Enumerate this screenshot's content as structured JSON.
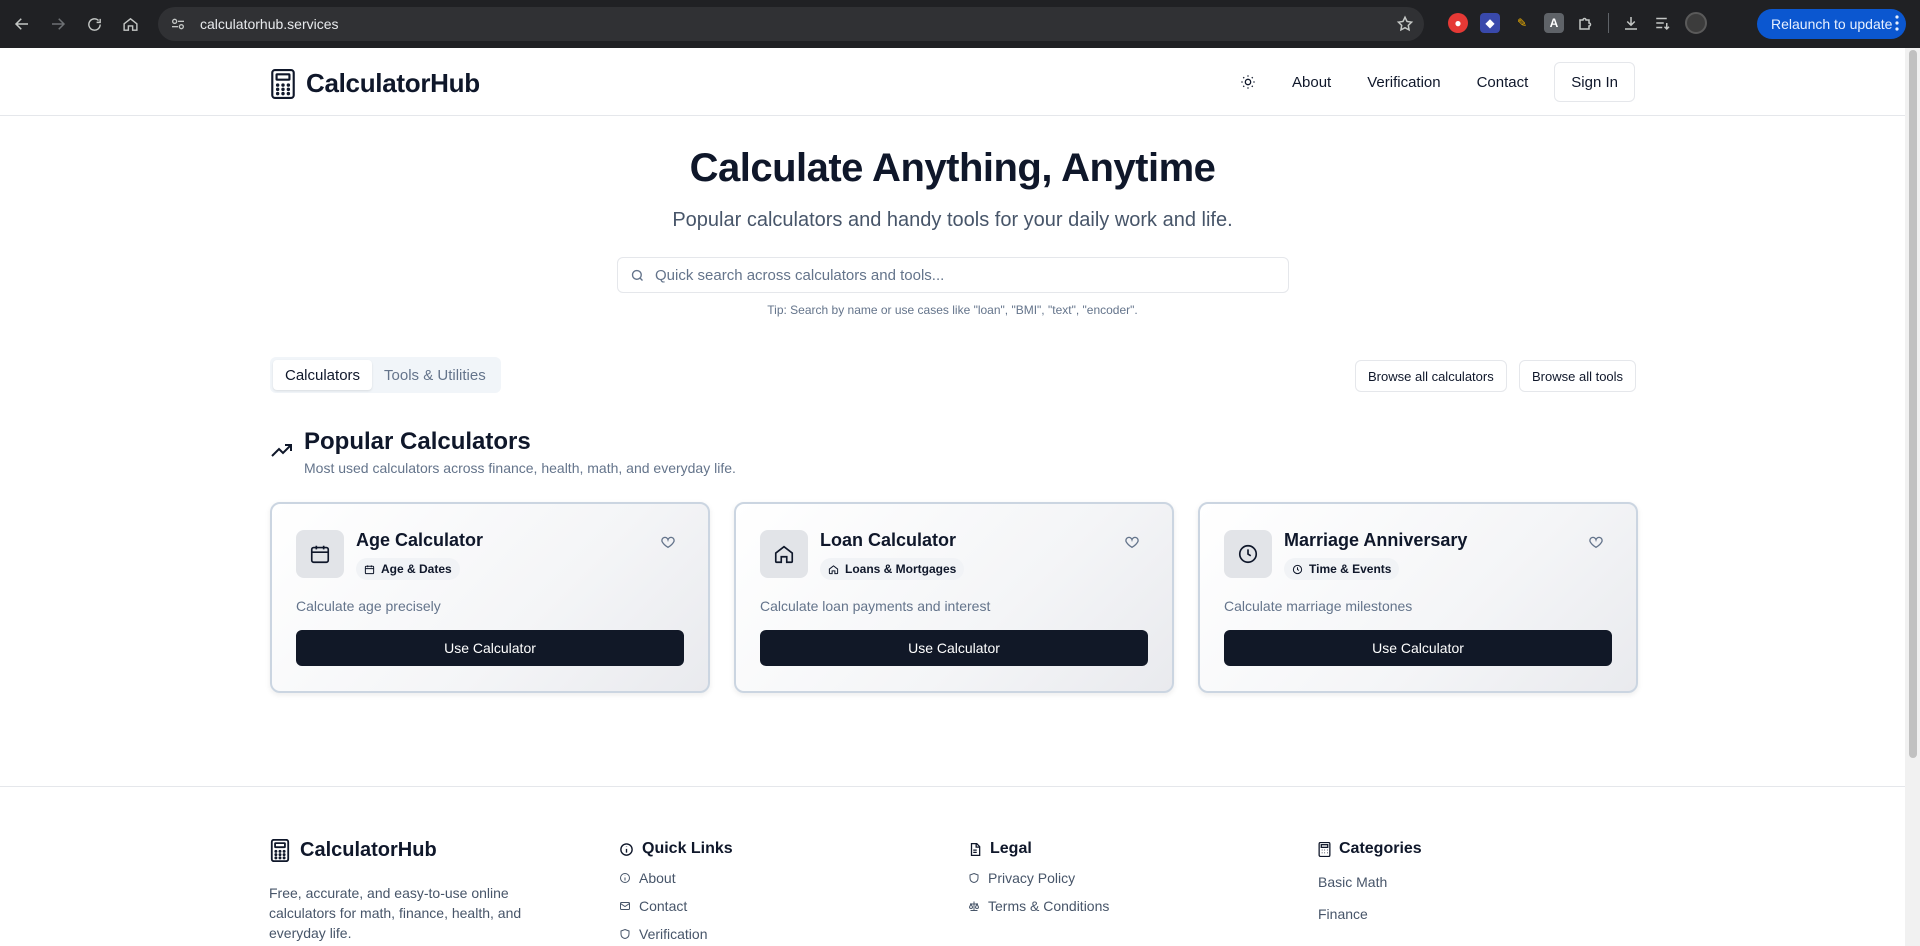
{
  "browser": {
    "url": "calculatorhub.services",
    "relaunch_label": "Relaunch to update"
  },
  "header": {
    "brand": "CalculatorHub",
    "nav": {
      "about": "About",
      "verification": "Verification",
      "contact": "Contact"
    },
    "signin_label": "Sign In"
  },
  "hero": {
    "title": "Calculate Anything, Anytime",
    "subtitle": "Popular calculators and handy tools for your daily work and life.",
    "search_placeholder": "Quick search across calculators and tools...",
    "search_value": "",
    "tip": "Tip: Search by name or use cases like \"loan\", \"BMI\", \"text\", \"encoder\"."
  },
  "tabs": {
    "calculators": "Calculators",
    "tools": "Tools & Utilities",
    "active": "Calculators"
  },
  "browse": {
    "calculators": "Browse all calculators",
    "tools": "Browse all tools"
  },
  "section": {
    "title": "Popular Calculators",
    "subtitle": "Most used calculators across finance, health, math, and everyday life."
  },
  "cards": [
    {
      "title": "Age Calculator",
      "category": "Age & Dates",
      "description": "Calculate age precisely",
      "button": "Use Calculator",
      "icon": "calendar-icon"
    },
    {
      "title": "Loan Calculator",
      "category": "Loans & Mortgages",
      "description": "Calculate loan payments and interest",
      "button": "Use Calculator",
      "icon": "home-icon"
    },
    {
      "title": "Marriage Anniversary",
      "category": "Time & Events",
      "description": "Calculate marriage milestones",
      "button": "Use Calculator",
      "icon": "clock-icon"
    }
  ],
  "footer": {
    "brand": "CalculatorHub",
    "description": "Free, accurate, and easy-to-use online calculators for math, finance, health, and everyday life.",
    "quick_links": {
      "title": "Quick Links",
      "items": [
        "About",
        "Contact",
        "Verification"
      ]
    },
    "legal": {
      "title": "Legal",
      "items": [
        "Privacy Policy",
        "Terms & Conditions"
      ]
    },
    "categories": {
      "title": "Categories",
      "items": [
        "Basic Math",
        "Finance"
      ]
    }
  },
  "colors": {
    "primary_button": "#111827",
    "text": "#0f172a",
    "muted": "#64748b",
    "relaunch": "#0b57d0"
  }
}
